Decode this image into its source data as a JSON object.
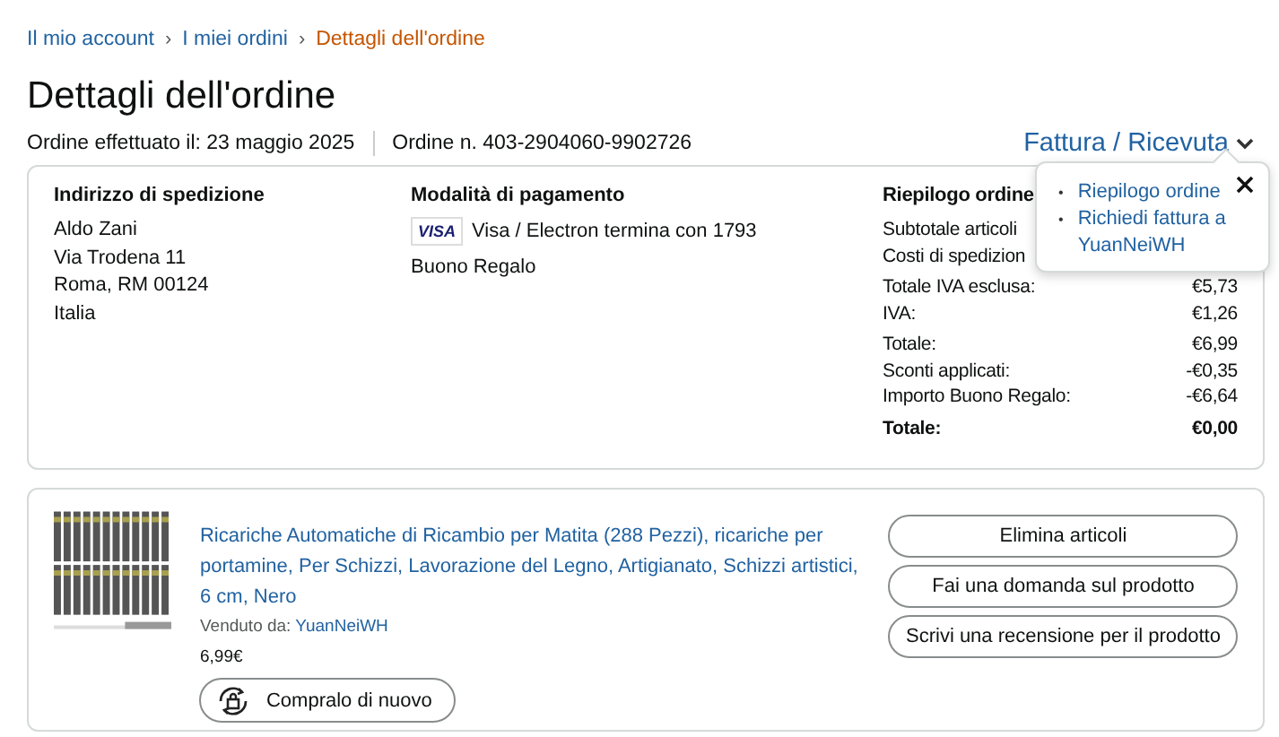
{
  "breadcrumb": [
    {
      "label": "Il mio account",
      "current": false
    },
    {
      "label": "I miei ordini",
      "current": false
    },
    {
      "label": "Dettagli dell'ordine",
      "current": true
    }
  ],
  "breadcrumb_separator": "›",
  "title": "Dettagli dell'ordine",
  "order_date": "Ordine effettuato il: 23 maggio 2025",
  "order_number": "Ordine n. 403-2904060-9902726",
  "invoice_link": "Fattura / Ricevuta",
  "shipping": {
    "heading": "Indirizzo di spedizione",
    "lines": [
      "Aldo Zani",
      "Via Trodena 11",
      "Roma, RM 00124",
      "Italia"
    ]
  },
  "payment": {
    "heading": "Modalità di pagamento",
    "card_brand": "VISA",
    "card": "Visa / Electron termina con 1793",
    "gift": "Buono Regalo"
  },
  "summary": {
    "heading": "Riepilogo ordine",
    "groups": [
      [
        {
          "kind": "line",
          "label": "Subtotale articoli"
        },
        {
          "kind": "line",
          "label": "Costi di spedizion"
        }
      ],
      [
        {
          "kind": "line",
          "label": "Totale IVA esclusa:",
          "value": "€5,73"
        },
        {
          "kind": "line",
          "label": "IVA:",
          "value": "€1,26"
        }
      ],
      [
        {
          "kind": "line",
          "label": "Totale:",
          "value": "€6,99"
        },
        {
          "kind": "line",
          "label": "Sconti applicati:",
          "value": "-€0,35"
        },
        {
          "kind": "line",
          "label": "Importo Buono Regalo:",
          "value": "-€6,64"
        }
      ],
      [
        {
          "kind": "total",
          "label": "Totale:",
          "value": "€0,00"
        }
      ]
    ]
  },
  "popover": {
    "marker": "•",
    "links": [
      "Riepilogo ordine",
      "Richiedi fattura a YuanNeiWH"
    ]
  },
  "item": {
    "title": "Ricariche Automatiche di Ricambio per Matita (288 Pezzi), ricariche per portamine, Per Schizzi, Lavorazione del Legno, Artigianato, Schizzi artistici, 6 cm, Nero",
    "seller_label": "Venduto da:",
    "seller": "YuanNeiWH",
    "price": "6,99€",
    "buy_again": "Compralo di nuovo",
    "actions": [
      "Elimina articoli",
      "Fai una domanda sul prodotto",
      "Scrivi una recensione per il prodotto"
    ]
  }
}
